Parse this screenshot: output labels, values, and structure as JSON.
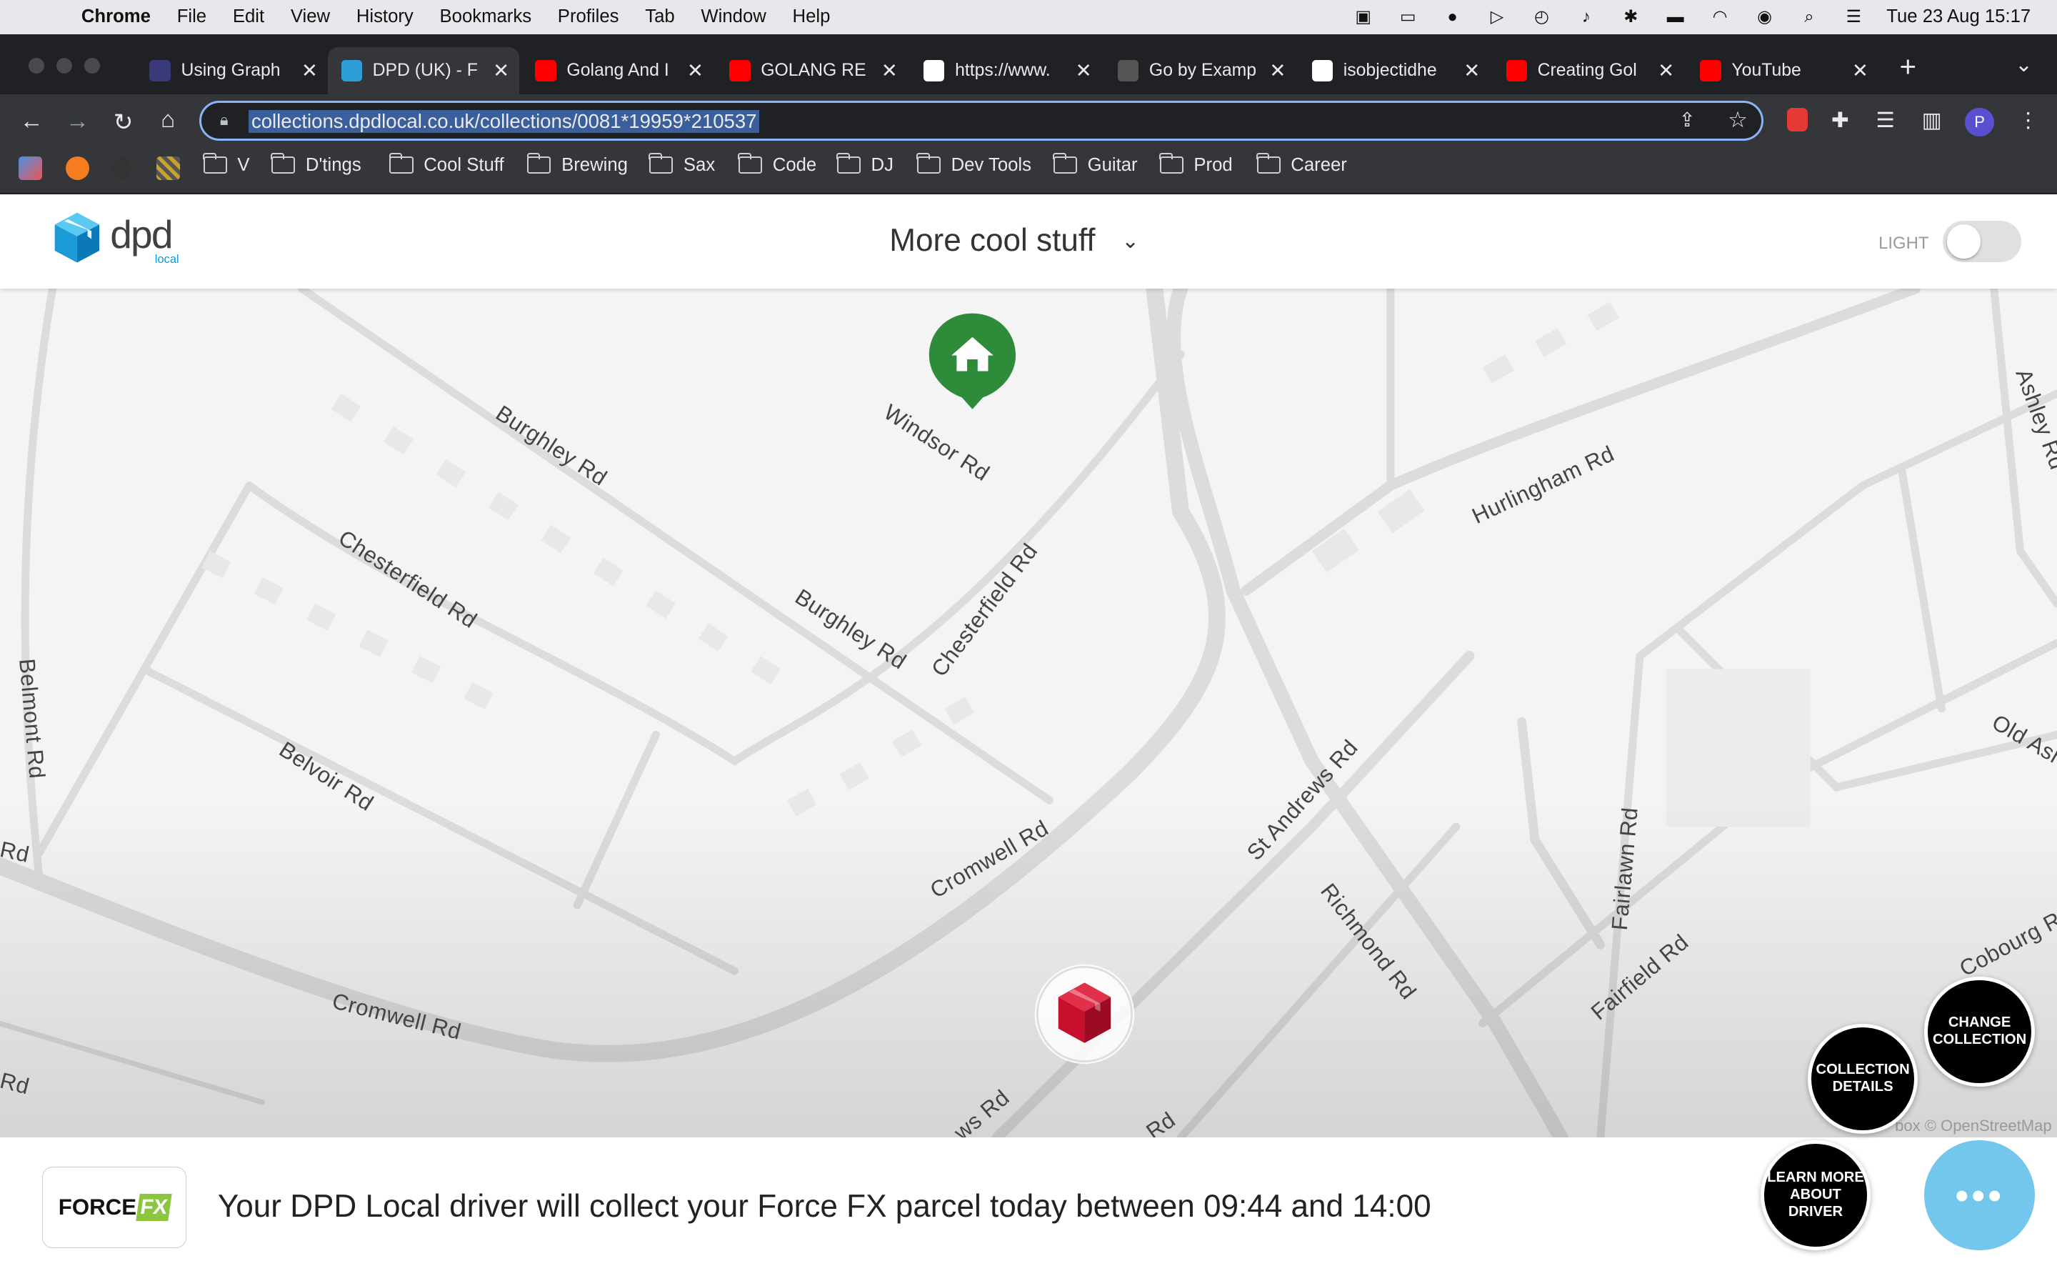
{
  "menubar": {
    "app": "Chrome",
    "items": [
      "File",
      "Edit",
      "View",
      "History",
      "Bookmarks",
      "Profiles",
      "Tab",
      "Window",
      "Help"
    ],
    "clock": "Tue 23 Aug  15:17"
  },
  "tabs": [
    {
      "title": "Using Graph",
      "favicon": "apollo-icon",
      "color": "#3a3a7a"
    },
    {
      "title": "DPD (UK) - F",
      "favicon": "dpd-cube-icon",
      "color": "#2e9fd6"
    },
    {
      "title": "Golang And I",
      "favicon": "youtube-icon",
      "color": "#ff0000"
    },
    {
      "title": "GOLANG RE",
      "favicon": "youtube-icon",
      "color": "#ff0000"
    },
    {
      "title": "https://www.",
      "favicon": "google-icon",
      "color": "#ffffff"
    },
    {
      "title": "Go by Examp",
      "favicon": "braces-icon",
      "color": "#555555"
    },
    {
      "title": "isobjectidhe",
      "favicon": "google-icon",
      "color": "#ffffff"
    },
    {
      "title": "Creating Gol",
      "favicon": "youtube-icon",
      "color": "#ff0000"
    },
    {
      "title": "YouTube",
      "favicon": "youtube-icon",
      "color": "#ff0000"
    }
  ],
  "omnibox": {
    "url": "collections.dpdlocal.co.uk/collections/0081*19959*210537"
  },
  "bookmarks": [
    "V",
    "D'tings",
    "Cool Stuff",
    "Brewing",
    "Sax",
    "Code",
    "DJ",
    "Dev Tools",
    "Guitar",
    "Prod",
    "Career"
  ],
  "header": {
    "logo_text": "dpd",
    "logo_sub": "local",
    "parcel_name": "More cool stuff",
    "theme_label": "LIGHT",
    "theme_on": false
  },
  "map": {
    "road_labels": [
      "Windsor Rd",
      "Burghley Rd",
      "Burghley Rd",
      "Chesterfield Rd",
      "Chesterfield Rd",
      "Belmont Rd",
      "Belvoir Rd",
      "Cromwell Rd",
      "Cromwell Rd",
      "St Andrews Rd",
      "Richmond Rd",
      "Hurlingham Rd",
      "Fairlawn Rd",
      "Fairfield Rd",
      "Ashley Rd",
      "Old Ash",
      "Cobourg R",
      "Rd",
      "Rd",
      "ws Rd",
      "Rd"
    ],
    "attribution": "box © OpenStreetMap"
  },
  "actions": {
    "change_collection": "CHANGE COLLECTION",
    "collection_details": "COLLECTION DETAILS",
    "learn_driver": "LEARN MORE ABOUT DRIVER",
    "more": "•••"
  },
  "footer": {
    "brand_a": "FORCE",
    "brand_b": "FX",
    "message": "Your DPD Local driver will collect your Force FX parcel today between 09:44 and 14:00"
  },
  "colors": {
    "home_pin": "#2e8b3a",
    "dpd_red": "#c8102e",
    "chat": "#73c6ec"
  }
}
